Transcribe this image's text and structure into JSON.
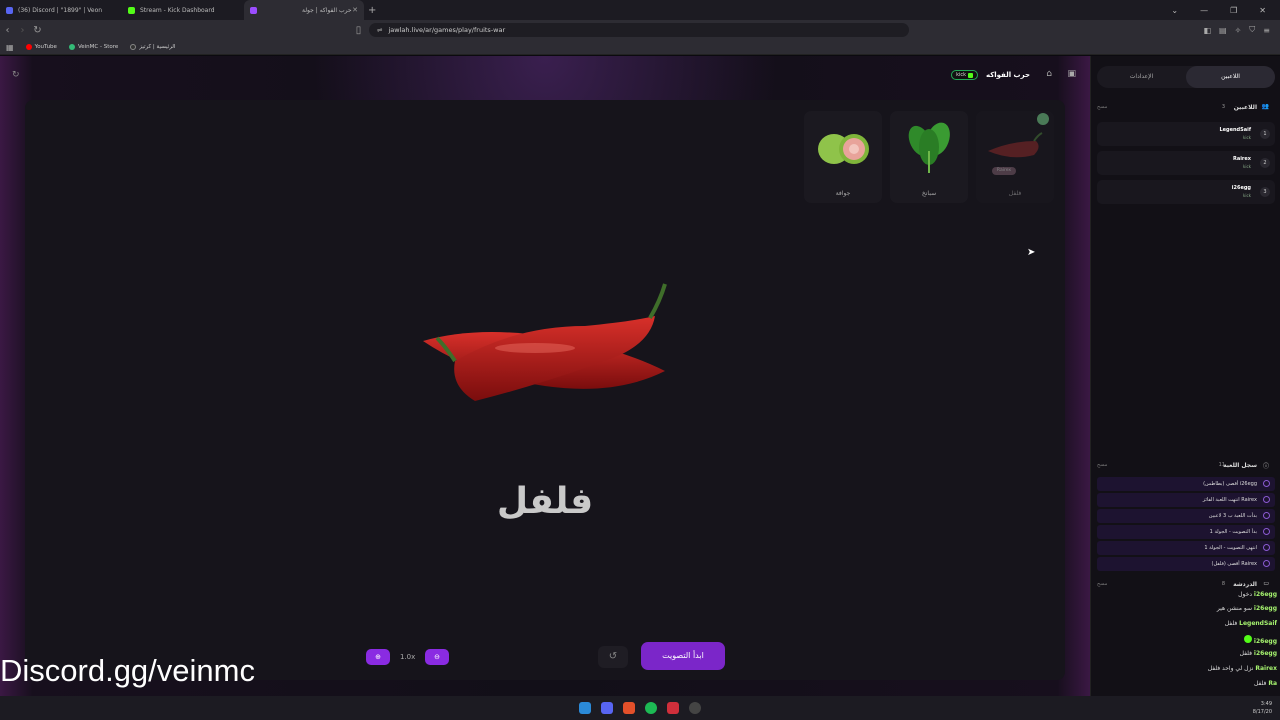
{
  "browser": {
    "tabs": [
      {
        "label": "(36) Discord | \"1899\" | Veon",
        "active": false
      },
      {
        "label": "Stream - Kick Dashboard",
        "active": false
      },
      {
        "label": "حرب الفواكه | جولة",
        "active": true
      }
    ],
    "url": "jawlah.live/ar/games/play/fruits-war",
    "bookmarks": [
      "YouTube",
      "VeinMC - Store",
      "الرئيسية | كرتيز"
    ]
  },
  "game": {
    "title": "حرب الفواكه",
    "platform_badge": "kick",
    "options": [
      {
        "name": "جوافة",
        "fruit": "guava"
      },
      {
        "name": "سبانخ",
        "fruit": "spinach"
      },
      {
        "name": "فلفل",
        "fruit": "pepper",
        "voter": "Rairex",
        "selected": true
      }
    ],
    "current_word": "فلفل",
    "zoom_level": "1.0x",
    "start_vote_label": "ابدأ التصويت"
  },
  "sidebar": {
    "tabs": [
      {
        "label": "اللاعبين",
        "active": true
      },
      {
        "label": "الإعدادات",
        "active": false
      }
    ],
    "players_section": {
      "title": "اللاعبين",
      "count": "3",
      "clear": "مسح"
    },
    "players": [
      {
        "rank": "1",
        "name": "LegendSaif",
        "platform": "kick"
      },
      {
        "rank": "2",
        "name": "Rairex",
        "platform": "kick"
      },
      {
        "rank": "3",
        "name": "i26egg",
        "platform": "kick"
      }
    ],
    "log_section": {
      "title": "سجل اللعبة",
      "count": "11",
      "clear": "مسح"
    },
    "log": [
      "i26egg أقصى (بطاطس)",
      "Rairex انتهت اللعبة الفائز",
      "بدأت اللعبة ب 3 لاعبين",
      "بدأ التصويت - الجولة 1",
      "انتهى التصويت - الجولة 1",
      "Rairex أقصى (فلفل)"
    ],
    "chat_section": {
      "title": "الدردشة",
      "count": "8",
      "clear": "مسح"
    },
    "chat": [
      {
        "user": "i26egg",
        "text": "دخول"
      },
      {
        "user": "i26egg",
        "text": "سو منشن هير"
      },
      {
        "user": "LegendSaif",
        "text": "فلفل"
      },
      {
        "user": "i26egg",
        "text": ""
      },
      {
        "user": "i26egg",
        "text": "فلفل"
      },
      {
        "user": "Rairex",
        "text": "نزل لي واحد فلفل"
      },
      {
        "user": "Ra",
        "text": "فلفل"
      }
    ]
  },
  "overlay": {
    "watermark": "Discord.gg/veinmc"
  },
  "taskbar": {
    "time": "3:49",
    "date": "8/17/20"
  }
}
